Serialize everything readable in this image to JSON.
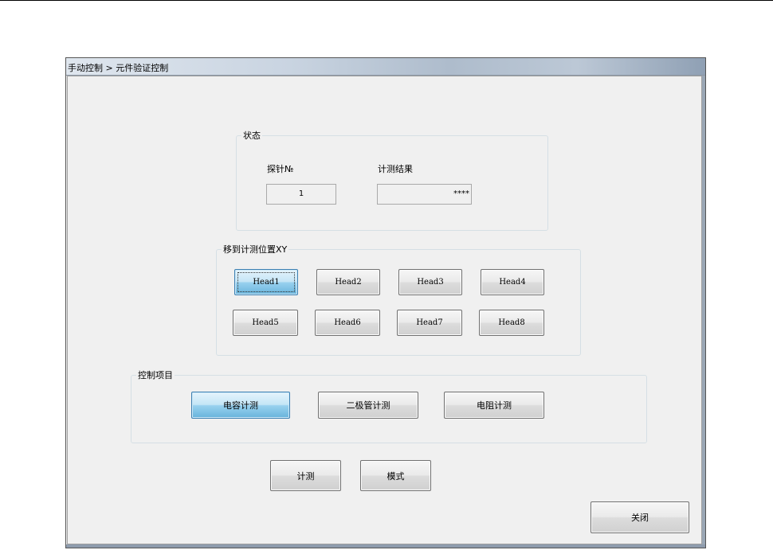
{
  "window": {
    "title": "手动控制 > 元件验证控制"
  },
  "status_group": {
    "label": "状态",
    "probe_label": "探针№",
    "probe_value": "1",
    "result_label": "计测结果",
    "result_value": "****"
  },
  "move_group": {
    "label": "移到计测位置XY",
    "heads": [
      "Head1",
      "Head2",
      "Head3",
      "Head4",
      "Head5",
      "Head6",
      "Head7",
      "Head8"
    ],
    "selected_head": "Head1"
  },
  "control_group": {
    "label": "控制项目",
    "items": [
      "电容计测",
      "二极管计测",
      "电阻计测"
    ],
    "selected_item": "电容计测"
  },
  "actions": {
    "measure": "计测",
    "mode": "模式",
    "close": "关闭"
  }
}
